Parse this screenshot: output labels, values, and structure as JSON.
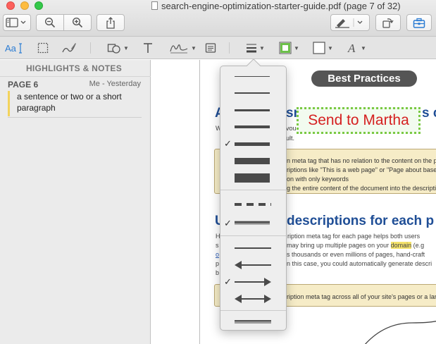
{
  "window": {
    "title": "search-engine-optimization-starter-guide.pdf (page 7 of 32)"
  },
  "sidebar": {
    "header": "HIGHLIGHTS & NOTES",
    "notes": [
      {
        "page": "PAGE 6",
        "meta": "Me - Yesterday",
        "text": "a sentence or two or a short paragraph"
      }
    ]
  },
  "document": {
    "section_pill": "Best Practices",
    "heading1_left": "A",
    "heading1_mid": "sr",
    "heading1_right": "s c",
    "body1_line1_left": "W",
    "body1_line1_mid": "vou",
    "body1_line1_right": "",
    "body1_line2_right": "ult.",
    "callout1": {
      "line1": "n meta tag that has no relation to the content on the pa",
      "line2": "riptions like \"This is a web page\" or \"Page about baseba",
      "line3": "on with only keywords",
      "line4": "g the entire content of the document into the descriptio"
    },
    "heading2_left": "U",
    "heading2_right": "descriptions for each p",
    "body2": {
      "line1_left": "H",
      "line1_right": "ription meta tag for each page helps both users",
      "line2_left": "s",
      "line2_mid": "may bring up multiple pages on your",
      "line2_domain": "domain",
      "line2_tail": "(e.g",
      "line3_left": "o",
      "line3_right": "s thousands or even millions of pages, hand-craft",
      "line4_left": "p",
      "line4_right": "n this case, you could automatically generate descri",
      "line5_left": "b"
    },
    "callout2": {
      "line1": "ription meta tag across all of your site's pages or a large"
    },
    "stamp_text": "Send to Martha",
    "colors": {
      "stamp_border": "#7ac943",
      "stamp_text": "#d52020",
      "heading": "#1f4e96",
      "callout_bg": "#f6ecc7",
      "highlight": "#f4e26b"
    }
  },
  "line_style_menu": {
    "selected_weight_index": 4,
    "selected_dash_index": 1,
    "selected_arrow_index": 2
  },
  "icons": {
    "sidebar_toggle": "sidebar-icon",
    "zoom_out": "zoom-out-icon",
    "zoom_in": "zoom-in-icon",
    "share": "share-icon",
    "markup": "pen-icon",
    "rotate": "rotate-icon",
    "toolbox": "toolbox-icon",
    "text_select": "text-select-icon",
    "rect_select": "rect-select-icon",
    "sketch": "sketch-icon",
    "shapes": "shapes-icon",
    "text": "text-icon",
    "sign": "signature-icon",
    "note": "note-icon",
    "line_style": "line-style-icon",
    "border_color": "border-color-icon",
    "fill_color": "fill-color-icon",
    "font": "font-icon"
  }
}
